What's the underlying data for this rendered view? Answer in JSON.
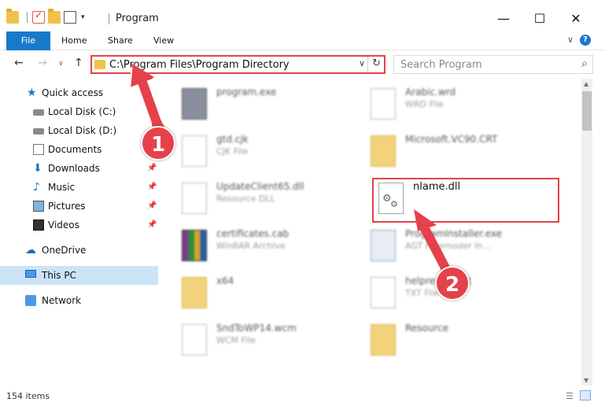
{
  "window": {
    "title": "Program",
    "minimize": "—",
    "maximize": "☐",
    "close": "✕"
  },
  "ribbon": {
    "tabs": [
      "File",
      "Home",
      "Share",
      "View"
    ],
    "expand": "∨",
    "help": "?"
  },
  "nav": {
    "back": "←",
    "forward": "→",
    "recent": "∨",
    "up": "↑",
    "address": "C:\\Program Files\\Program Directory",
    "dropdown": "∨",
    "refresh": "↻",
    "search_placeholder": "Search Program",
    "search_icon": "⌕"
  },
  "sidebar": {
    "items": [
      {
        "label": "Quick access",
        "icon": "star-icon",
        "pinned": false
      },
      {
        "label": "Local Disk (C:)",
        "icon": "disk-icon",
        "pinned": true
      },
      {
        "label": "Local Disk (D:)",
        "icon": "disk-icon",
        "pinned": false
      },
      {
        "label": "Documents",
        "icon": "document-icon",
        "pinned": true
      },
      {
        "label": "Downloads",
        "icon": "download-icon",
        "pinned": true
      },
      {
        "label": "Music",
        "icon": "music-icon",
        "pinned": true
      },
      {
        "label": "Pictures",
        "icon": "picture-icon",
        "pinned": true
      },
      {
        "label": "Videos",
        "icon": "video-icon",
        "pinned": true
      },
      {
        "label": "OneDrive",
        "icon": "cloud-icon",
        "pinned": false
      },
      {
        "label": "This PC",
        "icon": "computer-icon",
        "pinned": false,
        "selected": true
      },
      {
        "label": "Network",
        "icon": "network-icon",
        "pinned": false
      }
    ],
    "pin_glyph": "📌"
  },
  "files": [
    {
      "name": "program.exe",
      "type": ""
    },
    {
      "name": "Arabic.wrd",
      "type": "WRD File"
    },
    {
      "name": "gtd.cjk",
      "type": "CJK File"
    },
    {
      "name": "Microsoft.VC90.CRT",
      "type": ""
    },
    {
      "name": "UpdateClient65.dll",
      "type": "Resource DLL"
    },
    {
      "name": "nlame.dll",
      "type": ""
    },
    {
      "name": "certificates.cab",
      "type": "WinRAR Archive"
    },
    {
      "name": "ProgramInstaller.exe",
      "type": "AGT Freemoder In..."
    },
    {
      "name": "x64",
      "type": ""
    },
    {
      "name": "helpreader.txt",
      "type": "TXT File"
    },
    {
      "name": "SndToWP14.wcm",
      "type": "WCM File"
    },
    {
      "name": "Resource",
      "type": ""
    }
  ],
  "status": {
    "count": "154 items",
    "details_view": "☰",
    "icons_view": ""
  },
  "callouts": [
    "1",
    "2"
  ],
  "colors": {
    "accent": "#1979ca",
    "highlight": "#e5414a",
    "selected": "#cce4f7"
  }
}
